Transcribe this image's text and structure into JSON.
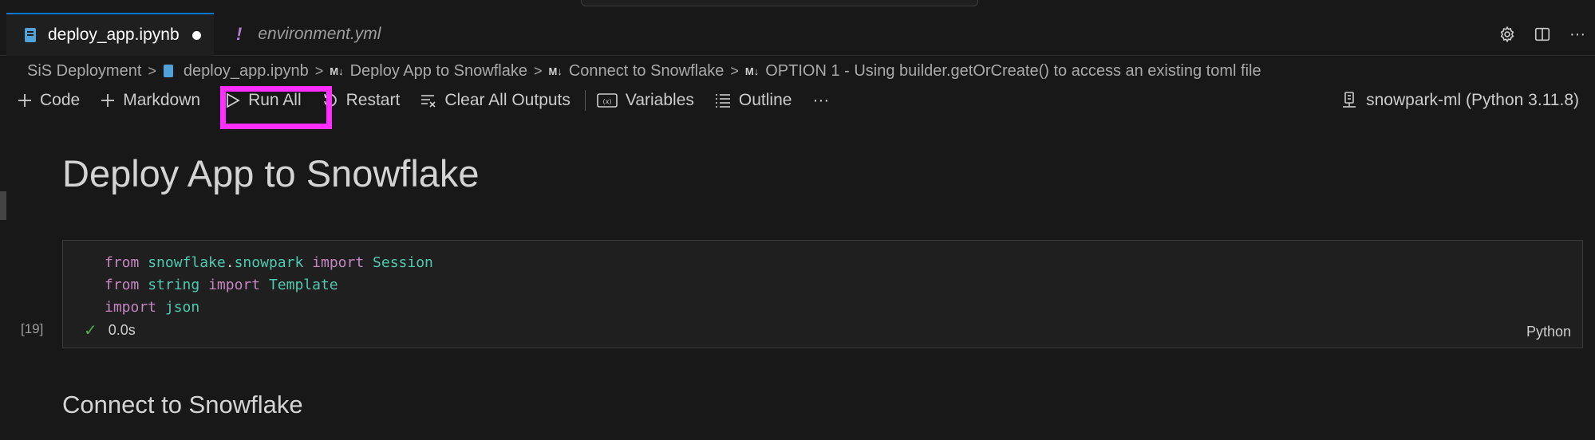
{
  "tabs": [
    {
      "label": "deploy_app.ipynb",
      "dirty": true,
      "icon": "notebook-file-icon"
    },
    {
      "label": "environment.yml",
      "icon": "yaml-exclamation-icon",
      "marker": "!"
    }
  ],
  "tab_actions": [
    "gear-icon",
    "split-editor-icon",
    "more-icon"
  ],
  "tab_actions_more": "···",
  "breadcrumb": {
    "items": [
      "SiS Deployment",
      "deploy_app.ipynb",
      "Deploy App to Snowflake",
      "Connect to Snowflake",
      "OPTION 1 - Using builder.getOrCreate() to access an existing toml file"
    ],
    "md_marker": "M↓",
    "separator": ">"
  },
  "toolbar": {
    "code_label": "Code",
    "markdown_label": "Markdown",
    "run_all_label": "Run All",
    "restart_label": "Restart",
    "clear_outputs_label": "Clear All Outputs",
    "variables_label": "Variables",
    "outline_label": "Outline",
    "more_label": "···"
  },
  "kernel": {
    "label": "snowpark-ml (Python 3.11.8)"
  },
  "highlight_color": "#ff2dff",
  "content": {
    "heading": "Deploy App to Snowflake",
    "cell": {
      "execution_count": "[19]",
      "lines": [
        {
          "kw1": "from",
          "mod1": "snowflake",
          "dot": ".",
          "mod2": "snowpark",
          "kw2": "import",
          "mod3": "Session"
        },
        {
          "kw1": "from",
          "mod1": "string",
          "kw2": "import",
          "mod3": "Template"
        },
        {
          "kw1": "import",
          "mod1": "json"
        }
      ],
      "status_time": "0.0s",
      "language": "Python"
    },
    "subheading": "Connect to Snowflake"
  }
}
